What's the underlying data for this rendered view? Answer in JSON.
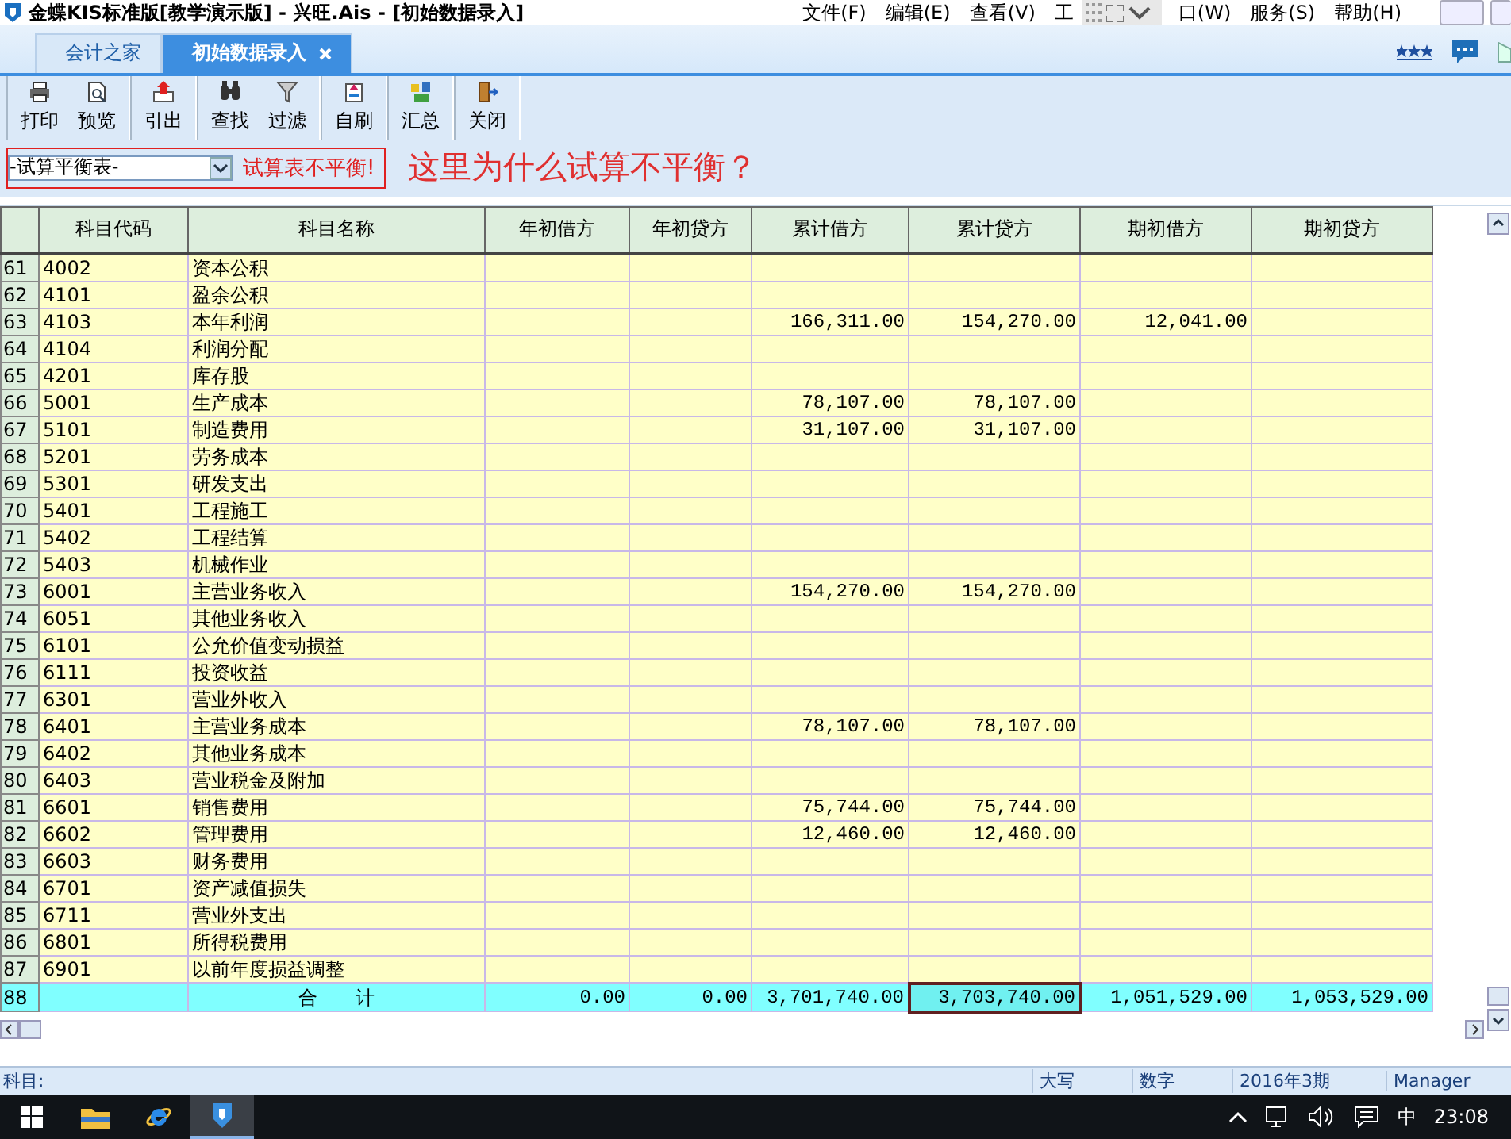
{
  "window": {
    "title": "金蝶KIS标准版[教学演示版] - 兴旺.Ais - [初始数据录入]"
  },
  "menu": [
    {
      "label": "文件(F)"
    },
    {
      "label": "编辑(E)"
    },
    {
      "label": "查看(V)"
    },
    {
      "label": "工"
    },
    {
      "label": "口(W)"
    },
    {
      "label": "服务(S)"
    },
    {
      "label": "帮助(H)"
    }
  ],
  "tabs": [
    {
      "label": "会计之家",
      "selected": false,
      "closable": false
    },
    {
      "label": "初始数据录入",
      "selected": true,
      "closable": true
    }
  ],
  "toolbar": [
    [
      {
        "label": "打印"
      },
      {
        "label": "预览"
      }
    ],
    [
      {
        "label": "引出"
      }
    ],
    [
      {
        "label": "查找"
      },
      {
        "label": "过滤"
      }
    ],
    [
      {
        "label": "自刷"
      }
    ],
    [
      {
        "label": "汇总"
      }
    ],
    [
      {
        "label": "关闭"
      }
    ]
  ],
  "report_select": {
    "value": "-试算平衡表-"
  },
  "warning": "试算表不平衡!",
  "annotation": "这里为什么试算不平衡？",
  "table": {
    "columns": [
      "科目代码",
      "科目名称",
      "年初借方",
      "年初贷方",
      "累计借方",
      "累计贷方",
      "期初借方",
      "期初贷方"
    ],
    "rows": [
      {
        "num": "61",
        "code": "4002",
        "name": "资本公积"
      },
      {
        "num": "62",
        "code": "4101",
        "name": "盈余公积"
      },
      {
        "num": "63",
        "code": "4103",
        "name": "本年利润",
        "cumulative_debit": "166,311.00",
        "cumulative_credit": "154,270.00",
        "opening_debit": "12,041.00"
      },
      {
        "num": "64",
        "code": "4104",
        "name": "利润分配"
      },
      {
        "num": "65",
        "code": "4201",
        "name": "库存股"
      },
      {
        "num": "66",
        "code": "5001",
        "name": "生产成本",
        "cumulative_debit": "78,107.00",
        "cumulative_credit": "78,107.00"
      },
      {
        "num": "67",
        "code": "5101",
        "name": "制造费用",
        "cumulative_debit": "31,107.00",
        "cumulative_credit": "31,107.00"
      },
      {
        "num": "68",
        "code": "5201",
        "name": "劳务成本"
      },
      {
        "num": "69",
        "code": "5301",
        "name": "研发支出"
      },
      {
        "num": "70",
        "code": "5401",
        "name": "工程施工"
      },
      {
        "num": "71",
        "code": "5402",
        "name": "工程结算"
      },
      {
        "num": "72",
        "code": "5403",
        "name": "机械作业"
      },
      {
        "num": "73",
        "code": "6001",
        "name": "主营业务收入",
        "cumulative_debit": "154,270.00",
        "cumulative_credit": "154,270.00"
      },
      {
        "num": "74",
        "code": "6051",
        "name": "其他业务收入"
      },
      {
        "num": "75",
        "code": "6101",
        "name": "公允价值变动损益"
      },
      {
        "num": "76",
        "code": "6111",
        "name": "投资收益"
      },
      {
        "num": "77",
        "code": "6301",
        "name": "营业外收入"
      },
      {
        "num": "78",
        "code": "6401",
        "name": "主营业务成本",
        "cumulative_debit": "78,107.00",
        "cumulative_credit": "78,107.00"
      },
      {
        "num": "79",
        "code": "6402",
        "name": "其他业务成本"
      },
      {
        "num": "80",
        "code": "6403",
        "name": "营业税金及附加"
      },
      {
        "num": "81",
        "code": "6601",
        "name": "销售费用",
        "cumulative_debit": "75,744.00",
        "cumulative_credit": "75,744.00"
      },
      {
        "num": "82",
        "code": "6602",
        "name": "管理费用",
        "cumulative_debit": "12,460.00",
        "cumulative_credit": "12,460.00"
      },
      {
        "num": "83",
        "code": "6603",
        "name": "财务费用"
      },
      {
        "num": "84",
        "code": "6701",
        "name": "资产减值损失"
      },
      {
        "num": "85",
        "code": "6711",
        "name": "营业外支出"
      },
      {
        "num": "86",
        "code": "6801",
        "name": "所得税费用"
      },
      {
        "num": "87",
        "code": "6901",
        "name": "以前年度损益调整"
      }
    ],
    "total": {
      "num": "88",
      "label": "合　　计",
      "cells": [
        {
          "text": "0.00",
          "selected": false
        },
        {
          "text": "0.00",
          "selected": false
        },
        {
          "text": "3,701,740.00",
          "selected": false
        },
        {
          "text": "3,703,740.00",
          "selected": true
        },
        {
          "text": "1,051,529.00",
          "selected": false
        },
        {
          "text": "1,053,529.00",
          "selected": false
        }
      ]
    }
  },
  "status_bar": {
    "label": "科目:",
    "fields": [
      "大写",
      "数字",
      "2016年3期",
      "Manager"
    ]
  },
  "taskbar": {
    "ime": "中",
    "time": "23:08"
  }
}
